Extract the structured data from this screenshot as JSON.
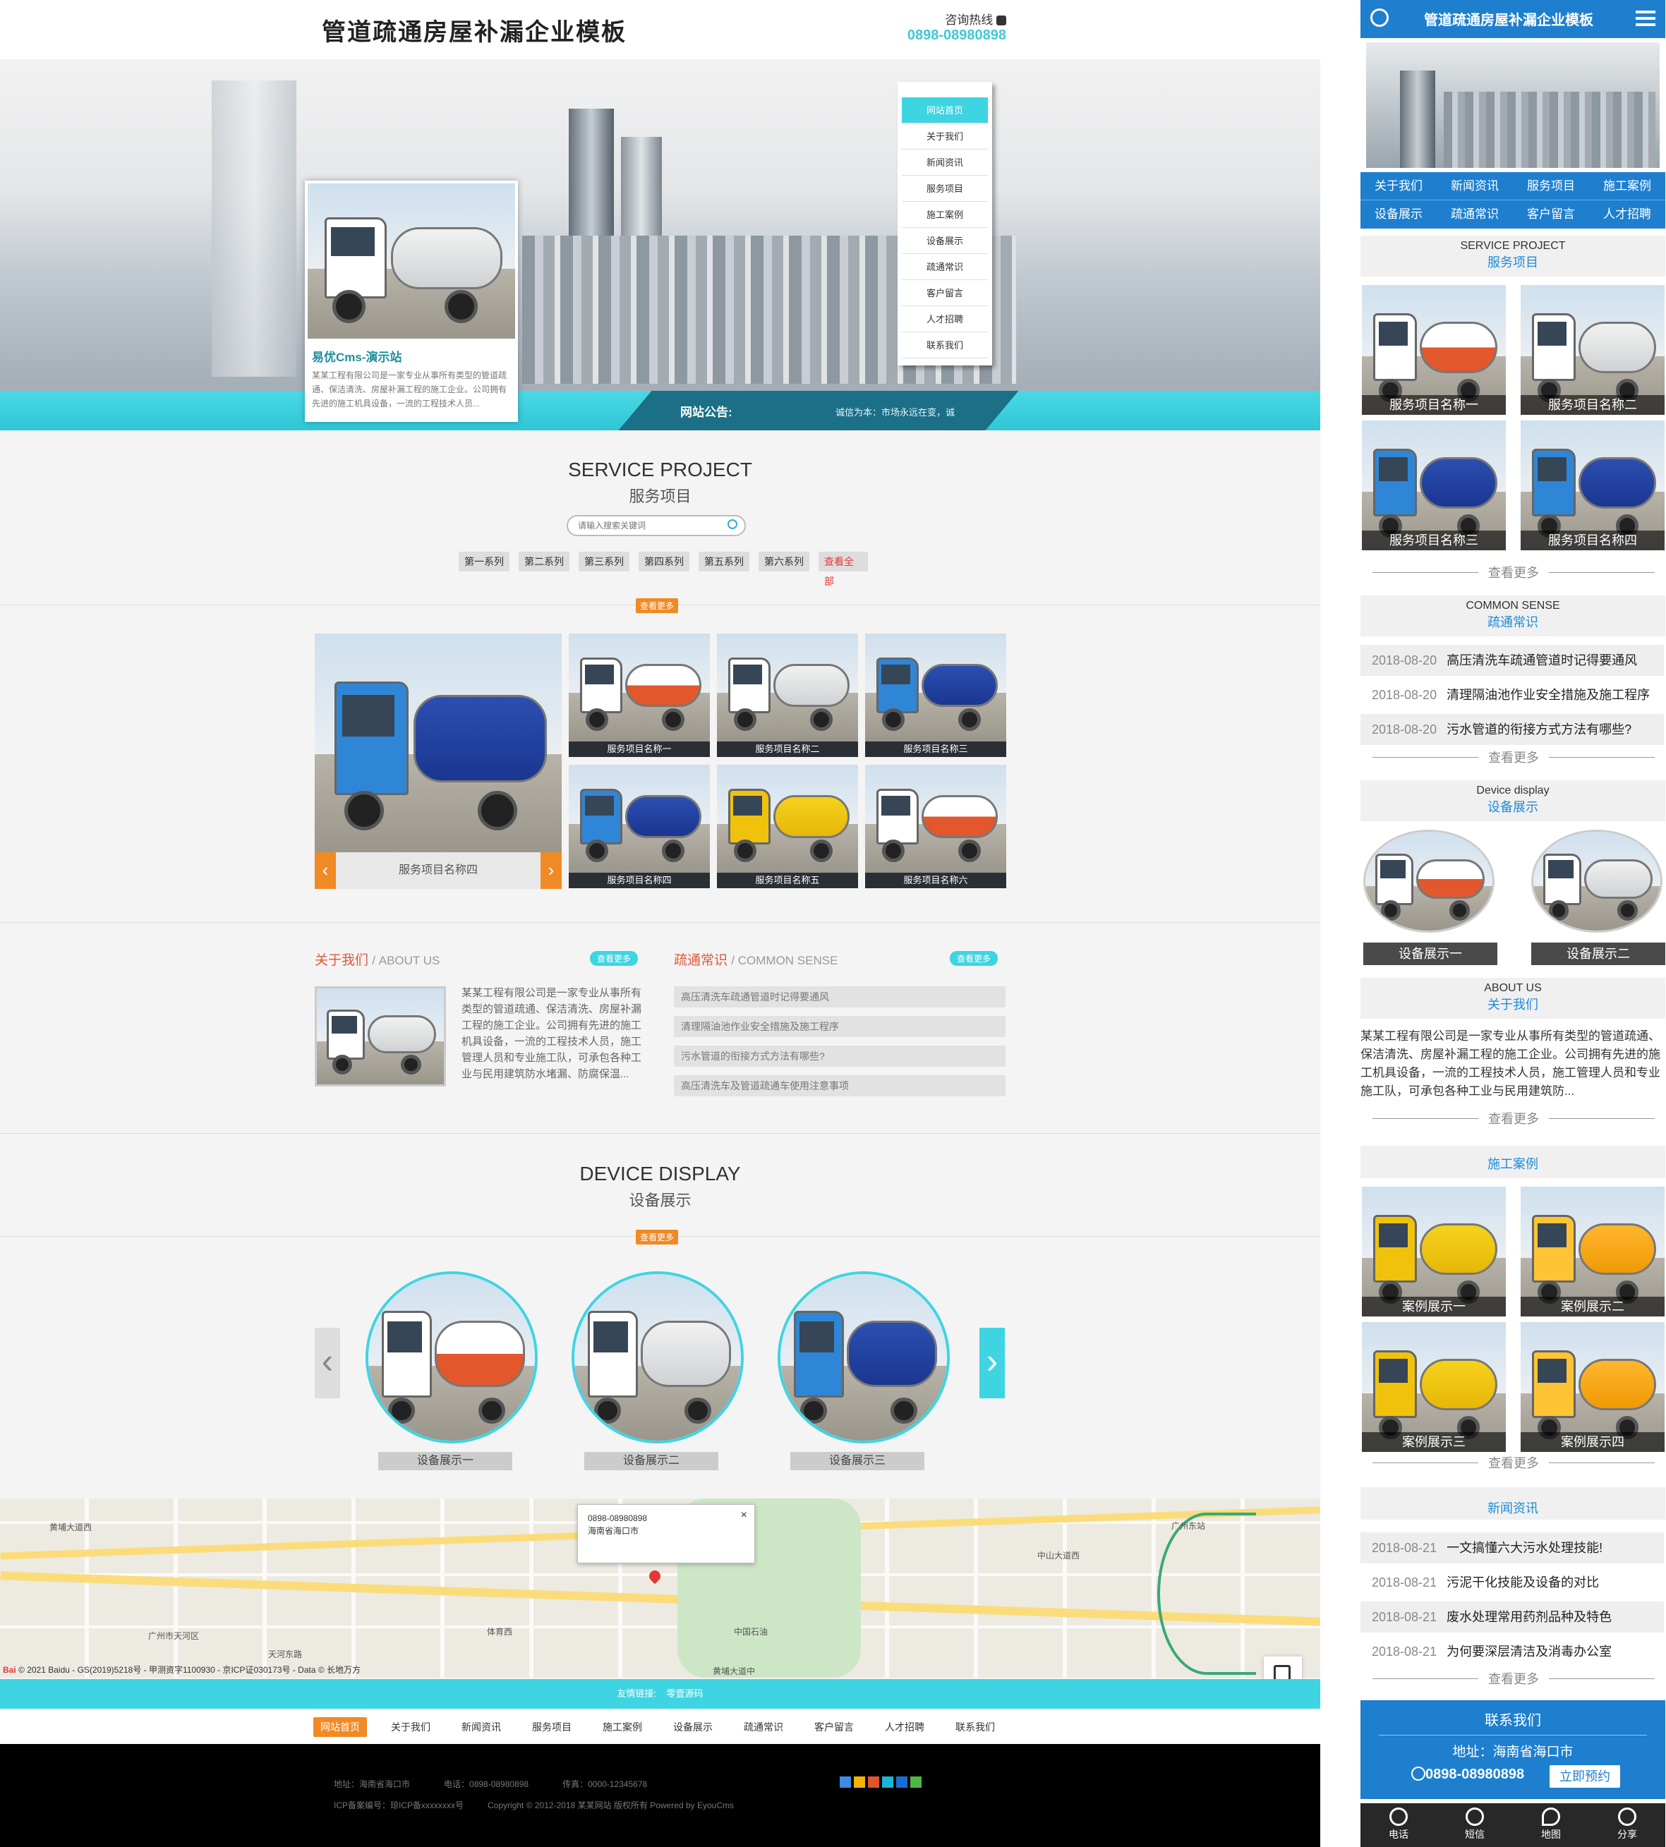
{
  "header": {
    "site_title": "管道疏通房屋补漏企业模板",
    "hotline_label": "咨询热线",
    "hotline_number": "0898-08980898"
  },
  "banner": {
    "notice_label": "网站公告:",
    "notice_text": "诚信为本：市场永远在变，诚",
    "promo_title": "易优Cms-演示站",
    "promo_text": "某某工程有限公司是一家专业从事所有类型的管道疏通、保洁清洗、房屋补漏工程的施工企业。公司拥有先进的施工机具设备，一流的工程技术人员..."
  },
  "side_nav": [
    "网站首页",
    "关于我们",
    "新闻资讯",
    "服务项目",
    "施工案例",
    "设备展示",
    "疏通常识",
    "客户留言",
    "人才招聘",
    "联系我们"
  ],
  "service": {
    "title_en": "SERVICE PROJECT",
    "title_cn": "服务项目",
    "search_placeholder": "请输入搜索关键词",
    "filters": [
      "第一系列",
      "第二系列",
      "第三系列",
      "第四系列",
      "第五系列",
      "第六系列",
      "查看全部"
    ],
    "more": "查看更多",
    "featured": "服务项目名称四",
    "items": [
      "服务项目名称一",
      "服务项目名称二",
      "服务项目名称三",
      "服务项目名称四",
      "服务项目名称五",
      "服务项目名称六"
    ]
  },
  "about": {
    "title_cn": "关于我们",
    "title_en": "/ ABOUT US",
    "more": "查看更多",
    "text": "某某工程有限公司是一家专业从事所有类型的管道疏通、保洁清洗、房屋补漏工程的施工企业。公司拥有先进的施工机具设备，一流的工程技术人员，施工管理人员和专业施工队，可承包各种工业与民用建筑防水堵漏、防腐保温..."
  },
  "sense": {
    "title_cn": "疏通常识",
    "title_en": "/ COMMON SENSE",
    "more": "查看更多",
    "items": [
      "高压清洗车疏通管道时记得要通风",
      "清理隔油池作业安全措施及施工程序",
      "污水管道的衔接方式方法有哪些?",
      "高压清洗车及管道疏通车使用注意事项"
    ]
  },
  "device": {
    "title_en": "DEVICE DISPLAY",
    "title_cn": "设备展示",
    "more": "查看更多",
    "items": [
      "设备展示一",
      "设备展示二",
      "设备展示三"
    ]
  },
  "map": {
    "popup_phone": "0898-08980898",
    "popup_address": "海南省海口市",
    "close": "×",
    "copyright": "© 2021 Baidu - GS(2019)5218号 - 甲测资字1100930 - 京ICP证030173号 - Data © 长地万方",
    "baidu": "Bai",
    "labels": [
      "黄埔大道西",
      "中山大道西",
      "黄埔大道中",
      "体育西",
      "天河东路",
      "中国石油",
      "广州市天河区",
      "广州东站"
    ]
  },
  "footer": {
    "links_label": "友情链接:",
    "links_item": "零壹源码",
    "nav": [
      "网站首页",
      "关于我们",
      "新闻资讯",
      "服务项目",
      "施工案例",
      "设备展示",
      "疏通常识",
      "客户留言",
      "人才招聘",
      "联系我们"
    ],
    "address": "地址：海南省海口市",
    "phone": "电话：0898-08980898",
    "fax": "传真：0000-12345678",
    "icp": "ICP备案编号：琼ICP备xxxxxxxx号",
    "copyright": "Copyright © 2012-2018 某某网站 版权所有 Powered by EyouCms"
  },
  "mobile": {
    "title": "管道疏通房屋补漏企业模板",
    "nav": [
      "关于我们",
      "新闻资讯",
      "服务项目",
      "施工案例",
      "设备展示",
      "疏通常识",
      "客户留言",
      "人才招聘"
    ],
    "service": {
      "en": "SERVICE PROJECT",
      "cn": "服务项目",
      "items": [
        "服务项目名称一",
        "服务项目名称二",
        "服务项目名称三",
        "服务项目名称四"
      ]
    },
    "more": "查看更多",
    "sense": {
      "en": "COMMON SENSE",
      "cn": "疏通常识",
      "items": [
        {
          "date": "2018-08-20",
          "title": "高压清洗车疏通管道时记得要通风"
        },
        {
          "date": "2018-08-20",
          "title": "清理隔油池作业安全措施及施工程序"
        },
        {
          "date": "2018-08-20",
          "title": "污水管道的衔接方式方法有哪些?"
        }
      ]
    },
    "device": {
      "en": "Device display",
      "cn": "设备展示",
      "items": [
        "设备展示一",
        "设备展示二"
      ]
    },
    "about": {
      "en": "ABOUT US",
      "cn": "关于我们",
      "text": "某某工程有限公司是一家专业从事所有类型的管道疏通、保洁清洗、房屋补漏工程的施工企业。公司拥有先进的施工机具设备，一流的工程技术人员，施工管理人员和专业施工队，可承包各种工业与民用建筑防..."
    },
    "cases": {
      "cn": "施工案例",
      "items": [
        "案例展示一",
        "案例展示二",
        "案例展示三",
        "案例展示四"
      ]
    },
    "news": {
      "cn": "新闻资讯",
      "items": [
        {
          "date": "2018-08-21",
          "title": "一文搞懂六大污水处理技能!"
        },
        {
          "date": "2018-08-21",
          "title": "污泥干化技能及设备的对比"
        },
        {
          "date": "2018-08-21",
          "title": "废水处理常用药剂品种及特色"
        },
        {
          "date": "2018-08-21",
          "title": "为何要深层清洁及消毒办公室"
        }
      ]
    },
    "contact": {
      "title": "联系我们",
      "address": "地址：海南省海口市",
      "phone": "0898-08980898",
      "book": "立即预约"
    },
    "bottom": [
      "电话",
      "短信",
      "地图",
      "分享"
    ]
  },
  "colors": {
    "cyan": "#3fd4e2",
    "blue": "#1e7fcf",
    "orange": "#f08a24",
    "red": "#e53935"
  }
}
